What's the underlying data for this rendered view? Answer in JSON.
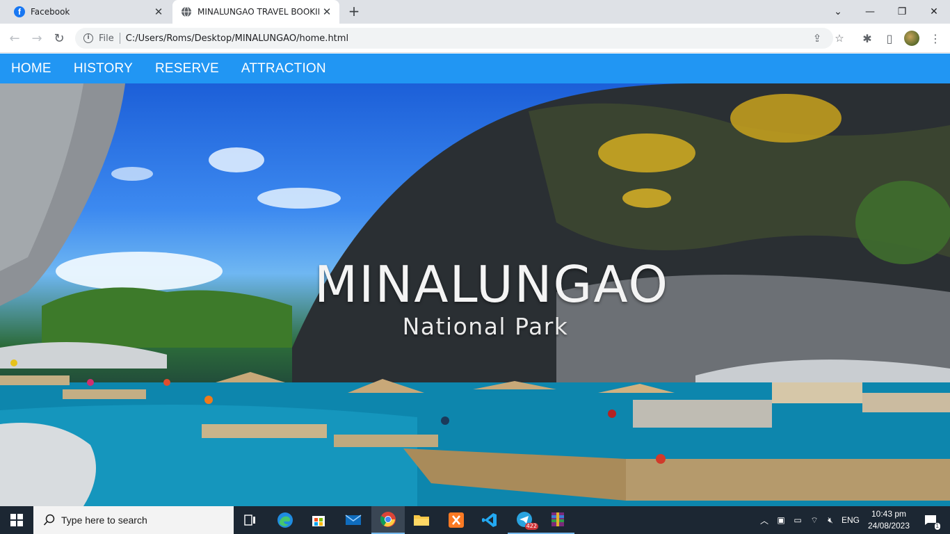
{
  "browser": {
    "tabs": [
      {
        "title": "Facebook",
        "icon": "facebook-icon",
        "active": false
      },
      {
        "title": "MINALUNGAO TRAVEL BOOKING",
        "icon": "globe-icon",
        "active": true
      }
    ],
    "address": {
      "scheme_label": "File",
      "url": "C:/Users/Roms/Desktop/MINALUNGAO/home.html"
    }
  },
  "site": {
    "nav": [
      {
        "label": "HOME"
      },
      {
        "label": "HISTORY"
      },
      {
        "label": "RESERVE"
      },
      {
        "label": "ATTRACTION"
      }
    ],
    "hero": {
      "title": "MINALUNGAO",
      "subtitle": "National Park"
    },
    "colors": {
      "nav_bg": "#2196f3",
      "nav_text": "#ffffff"
    }
  },
  "taskbar": {
    "search_placeholder": "Type here to search",
    "apps": [
      "task-view-icon",
      "edge-icon",
      "store-icon",
      "mail-icon",
      "chrome-icon",
      "file-explorer-icon",
      "xampp-icon",
      "vscode-icon",
      "telegram-icon",
      "winrar-icon"
    ],
    "telegram_badge": "422",
    "tray": {
      "language": "ENG",
      "time": "10:43 pm",
      "date": "24/08/2023",
      "notification_count": "1"
    }
  }
}
